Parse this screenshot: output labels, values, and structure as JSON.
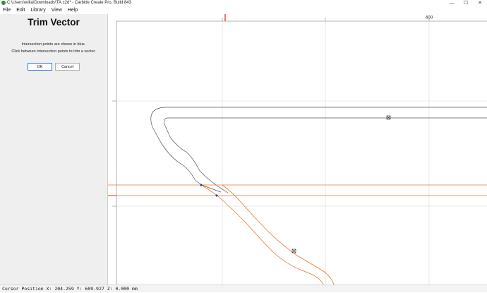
{
  "window": {
    "title": "C:\\Users\\willa\\Downloads\\TA.c2d* - Carbide Create Pro, Build 843",
    "controls": {
      "minimize": "—",
      "maximize": "☐",
      "close": "✕"
    }
  },
  "menu": [
    {
      "label": "File"
    },
    {
      "label": "Edit"
    },
    {
      "label": "Library"
    },
    {
      "label": "View"
    },
    {
      "label": "Help"
    }
  ],
  "panel": {
    "title": "Trim Vector",
    "line1": "Intersection points are shown in blue.",
    "line2": "Click between intersection points to trim a vector.",
    "ok_label": "OK",
    "cancel_label": "Cancel"
  },
  "ruler": {
    "label": "400"
  },
  "status": {
    "cursor_text": "Cursor Position X: 204.259 Y: 609.927 Z: 0.000 mm"
  },
  "colors": {
    "vector": "#555555",
    "selected_vector": "#e8772e",
    "ruler_mark": "#e02020",
    "grid": "#d8d8d8",
    "panel_bg": "#efefef"
  }
}
